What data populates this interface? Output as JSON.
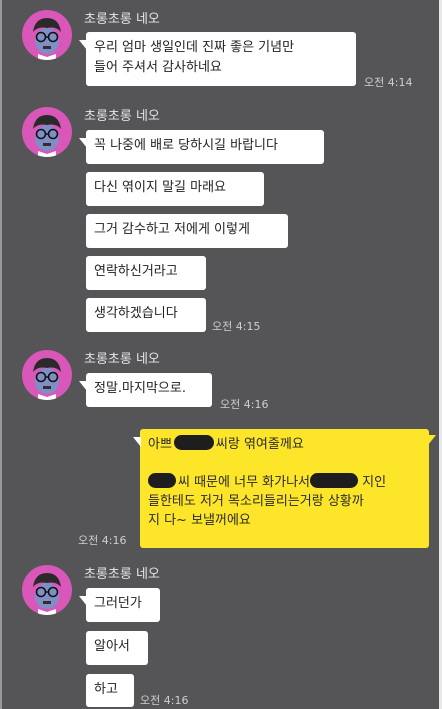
{
  "sender": "초롱초롱 네오",
  "groups": [
    {
      "messages": [
        "우리 엄마 생일인데 진짜 좋은 기념만",
        "들어 주셔서 감사하네요"
      ],
      "time": "오전 4:14"
    },
    {
      "messages": [
        "꼭 나중에 배로 당하시길 바랍니다",
        "다신 엮이지 말길 마래요",
        "그거 감수하고 저에게 이렇게",
        "연락하신거라고",
        "생각하겠습니다"
      ],
      "time": "오전 4:15"
    },
    {
      "messages": [
        "정말.마지막으로."
      ],
      "time": "오전 4:16"
    },
    {
      "messages": [
        "그러던가",
        "알아서",
        "하고"
      ],
      "time": "오전 4:16"
    }
  ],
  "mine": {
    "line1_start": "아쁘",
    "line1_end": "씨랑 엮여줄께요",
    "line2_mid": "씨 때문에 너무 화가나서",
    "line2_end": " 지인",
    "line3": "들한테도 저거 목소리들리는거랑 상황까",
    "line4": "지 다~ 보낼꺼에요",
    "time": "오전 4:16"
  },
  "colors": {
    "background": "#555558",
    "my_bubble": "#fde629",
    "other_bubble": "#ffffff",
    "avatar": "#d957b9"
  },
  "icons": [
    "neo-avatar-icon"
  ]
}
